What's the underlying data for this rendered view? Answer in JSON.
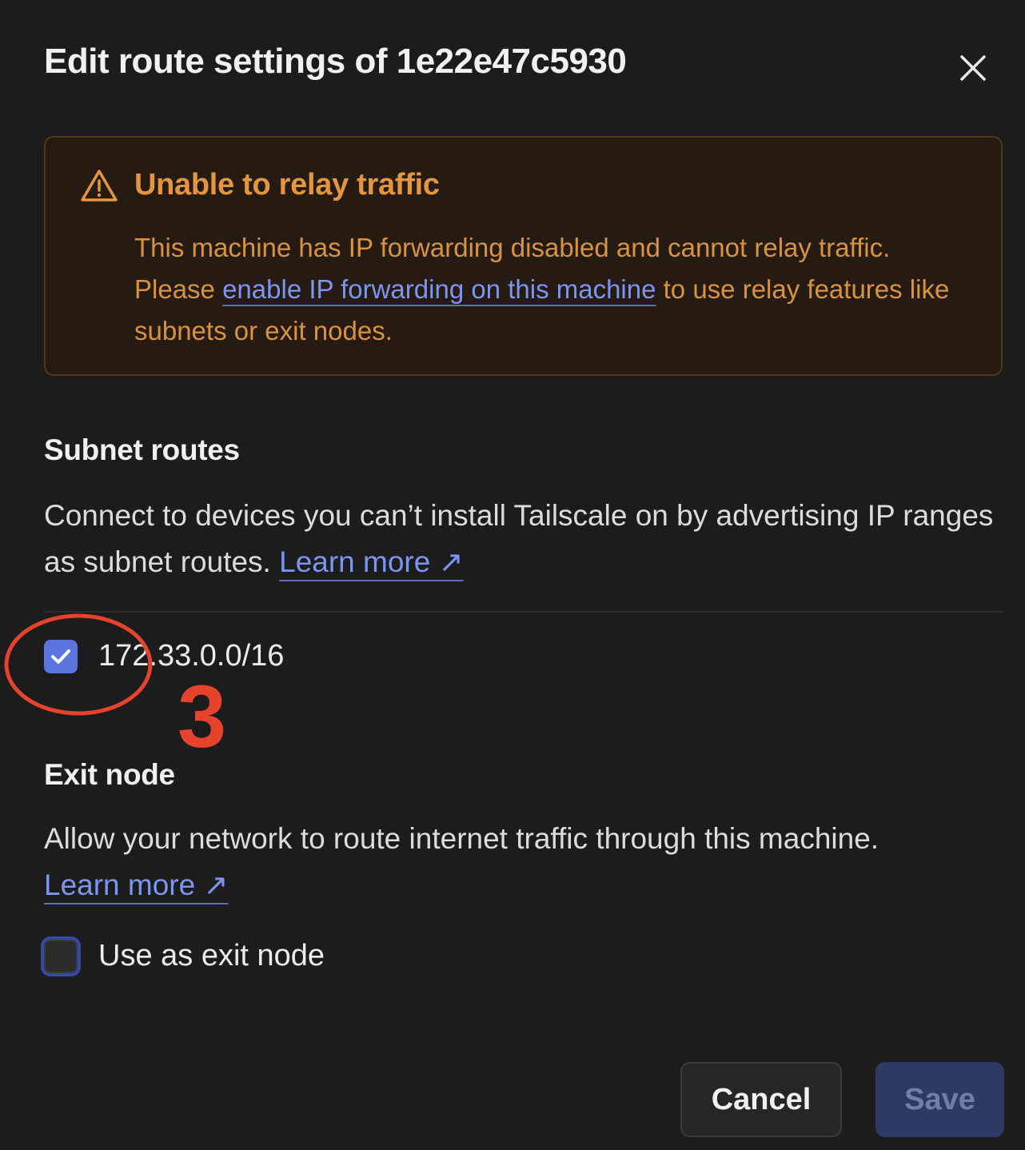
{
  "dialog": {
    "title": "Edit route settings of 1e22e47c5930",
    "close_icon": "close-icon"
  },
  "alert": {
    "icon": "warning-triangle-icon",
    "title": "Unable to relay traffic",
    "body_before": "This machine has IP forwarding disabled and cannot relay traffic. Please ",
    "body_link": "enable IP forwarding on this machine",
    "body_after": " to use relay features like subnets or exit nodes."
  },
  "subnet_routes": {
    "title": "Subnet routes",
    "description": "Connect to devices you can’t install Tailscale on by advertising IP ranges as subnet routes. ",
    "learn_more": "Learn more ↗",
    "routes": [
      {
        "cidr": "172.33.0.0/16",
        "checked": true
      }
    ]
  },
  "exit_node": {
    "title": "Exit node",
    "description": "Allow your network to route internet traffic through this machine. ",
    "learn_more": "Learn more ↗",
    "checkbox_label": "Use as exit node",
    "checked": false
  },
  "annotation": {
    "number": "3",
    "color": "#e5432c"
  },
  "footer": {
    "cancel_label": "Cancel",
    "save_label": "Save"
  },
  "colors": {
    "background": "#1c1c1c",
    "accent": "#5b74e0",
    "warning": "#e5963c",
    "link": "#7c95f0"
  }
}
